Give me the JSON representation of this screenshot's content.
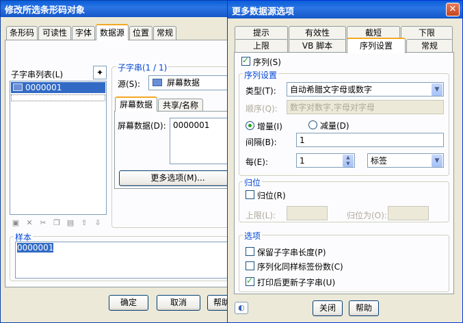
{
  "left_dialog": {
    "title": "修改所选条形码对象",
    "tabs": [
      "条形码",
      "可读性",
      "字体",
      "数据源",
      "位置",
      "常规"
    ],
    "substring_list_label": "子字串列表(L)",
    "substring_items": [
      "0000001"
    ],
    "substring_group_label": "子字串(1 / 1)",
    "source_label": "源(S):",
    "source_value": "屏幕数据",
    "inner_tabs": [
      "屏幕数据",
      "共享/名称"
    ],
    "screen_data_label": "屏幕数据(D):",
    "screen_data_value": "0000001",
    "more_options_button": "更多选项(M)...",
    "sample_label": "样本",
    "sample_value": "0000001",
    "buttons": {
      "ok": "确定",
      "cancel": "取消",
      "help": "帮助"
    }
  },
  "right_dialog": {
    "title": "更多数据源选项",
    "close_glyph": "✕",
    "tabs_top": [
      "提示",
      "有效性",
      "截短",
      "下限"
    ],
    "tabs_bottom": [
      "上限",
      "VB 脚本",
      "序列设置",
      "常规"
    ],
    "serial_checkbox": "序列(S)",
    "serial_group": "序列设置",
    "type_label": "类型(T):",
    "type_value": "自动希腊文字母或数字",
    "order_label": "顺序(Q):",
    "order_value": "数字对数字,字母对字母",
    "increment_label": "增量(I)",
    "decrement_label": "减量(D)",
    "interval_label": "间隔(B):",
    "interval_value": "1",
    "every_label": "每(E):",
    "every_value": "1",
    "every_unit": "标签",
    "reset_group": "归位",
    "reset_checkbox": "归位(R)",
    "upper_label": "上限(L):",
    "reset_to_label": "归位为(O):",
    "options_group": "选项",
    "opt_keep_length": "保留子字串长度(P)",
    "opt_serialize_copies": "序列化同样标签份数(C)",
    "opt_update_after_print": "打印后更新子字串(U)",
    "buttons": {
      "close": "关闭",
      "help": "帮助"
    }
  }
}
